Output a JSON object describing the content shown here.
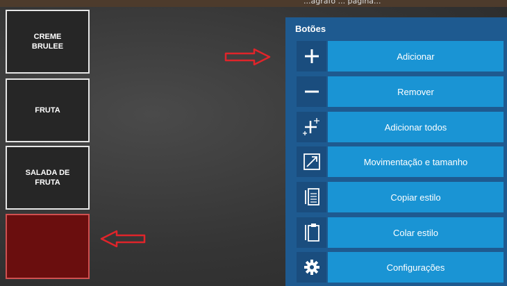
{
  "top_text": "...agrafo ... página...",
  "tiles": [
    {
      "label": "CREME\nBRULEE"
    },
    {
      "label": "FRUTA"
    },
    {
      "label": "SALADA DE\nFRUTA"
    },
    {
      "label": ""
    }
  ],
  "panel": {
    "title": "Botões",
    "buttons": [
      {
        "label": "Adicionar",
        "icon": "plus-icon"
      },
      {
        "label": "Remover",
        "icon": "minus-icon"
      },
      {
        "label": "Adicionar todos",
        "icon": "plus-multiple-icon"
      },
      {
        "label": "Movimentação e tamanho",
        "icon": "resize-icon"
      },
      {
        "label": "Copiar estilo",
        "icon": "copy-icon"
      },
      {
        "label": "Colar estilo",
        "icon": "paste-icon"
      },
      {
        "label": "Configurações",
        "icon": "gear-icon"
      }
    ]
  },
  "colors": {
    "panel_bg": "#1e5a90",
    "button_bg": "#1a94d4",
    "icon_bg": "#1a4d7e",
    "arrow": "#e0242a",
    "selected_tile": "#6a0e0e"
  }
}
